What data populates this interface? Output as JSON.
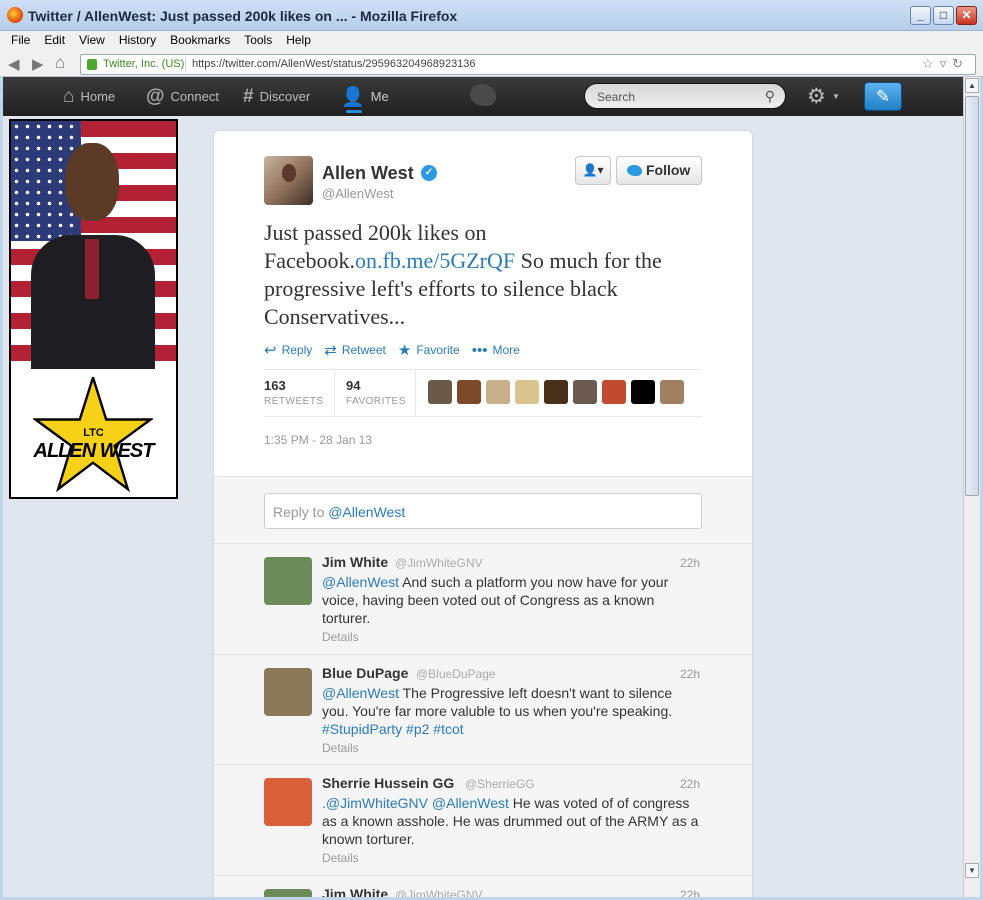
{
  "window": {
    "title": "Twitter / AllenWest: Just passed 200k likes on ... - Mozilla Firefox"
  },
  "menu": [
    "File",
    "Edit",
    "View",
    "History",
    "Bookmarks",
    "Tools",
    "Help"
  ],
  "address": {
    "site_identity": "Twitter, Inc. (US)",
    "url": "https://twitter.com/AllenWest/status/295963204968923136"
  },
  "twitter_nav": {
    "home": "Home",
    "connect": "Connect",
    "discover": "Discover",
    "me": "Me",
    "search_placeholder": "Search"
  },
  "ad": {
    "line1": "LTC",
    "line2": "ALLEN WEST"
  },
  "tweet": {
    "author_name": "Allen West",
    "author_handle": "@AllenWest",
    "follow_label": "Follow",
    "text_before_link": "Just passed 200k likes on Facebook.",
    "link": "on.fb.me/5GZrQF",
    "text_after_link": " So much for the progressive left's efforts to silence black Conservatives...",
    "actions": {
      "reply": "Reply",
      "retweet": "Retweet",
      "favorite": "Favorite",
      "more": "More"
    },
    "retweets": "163",
    "retweets_label": "RETWEETS",
    "favorites": "94",
    "favorites_label": "FAVORITES",
    "timestamp": "1:35 PM - 28 Jan 13",
    "favoriter_colors": [
      "#6b5a4a",
      "#7a4a2a",
      "#c8b08a",
      "#d9c48e",
      "#4a3018",
      "#6a5a50",
      "#c04a30",
      "#000000",
      "#a08060"
    ]
  },
  "reply_box": {
    "prefix": "Reply to ",
    "mention": "@AllenWest"
  },
  "replies": [
    {
      "name": "Jim White",
      "handle": "@JimWhiteGNV",
      "time": "22h",
      "mention": "@AllenWest",
      "text": " And such a platform you now have for your voice, having been voted out of Congress as a known torturer.",
      "details": "Details",
      "avatar_color": "#6c8a5a"
    },
    {
      "name": "Blue DuPage",
      "handle": "@BlueDuPage",
      "time": "22h",
      "mention": "@AllenWest",
      "text": " The Progressive left doesn't want to silence you. You're far more valuble to us when you're speaking. ",
      "hashtags": "#StupidParty #p2 #tcot",
      "details": "Details",
      "avatar_color": "#8a7a5a"
    },
    {
      "name": "Sherrie Hussein GG",
      "handle": "@SherrieGG",
      "time": "22h",
      "mention": ".@JimWhiteGNV @AllenWest",
      "text": " He was voted of of congress as a known asshole. He was drummed out of the ARMY as a known torturer.",
      "details": "Details",
      "avatar_color": "#d8603a"
    },
    {
      "name": "Jim White",
      "handle": "@JimWhiteGNV",
      "time": "22h",
      "avatar_color": "#6c8a5a"
    }
  ]
}
